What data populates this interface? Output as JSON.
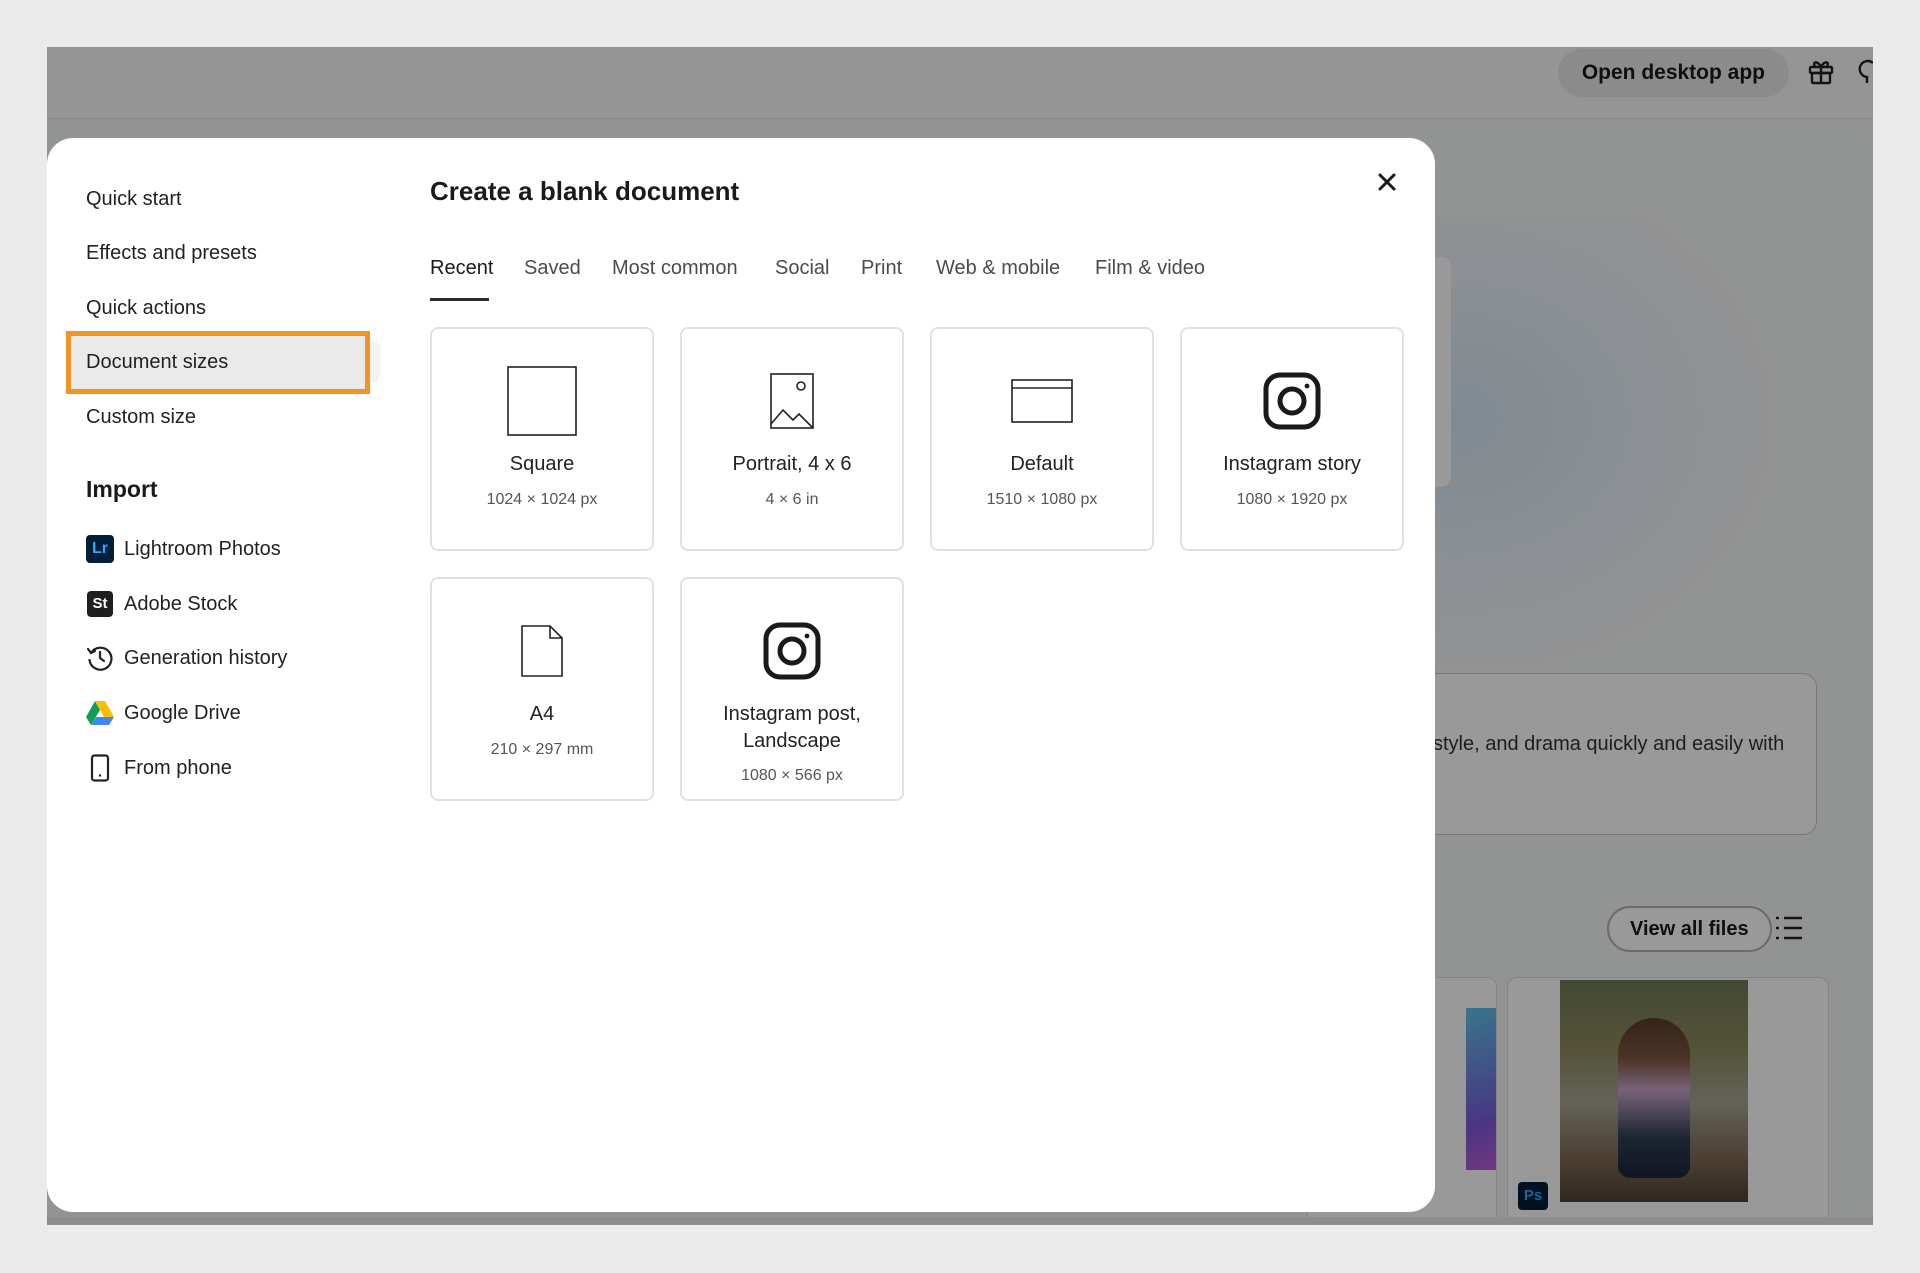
{
  "background": {
    "open_desktop_label": "Open desktop app",
    "promo_text": "style, and drama quickly and easily with",
    "view_all_label": "View all files",
    "ps_badge": "Ps"
  },
  "modal": {
    "title": "Create a blank document",
    "sidebar": {
      "items": [
        {
          "label": "Quick start"
        },
        {
          "label": "Effects and presets"
        },
        {
          "label": "Quick actions"
        },
        {
          "label": "Document sizes"
        },
        {
          "label": "Custom size"
        }
      ],
      "selected_index": 3,
      "import_heading": "Import",
      "import_items": [
        {
          "label": "Lightroom Photos",
          "icon": "lightroom-icon",
          "badge": "Lr"
        },
        {
          "label": "Adobe Stock",
          "icon": "adobe-stock-icon",
          "badge": "St"
        },
        {
          "label": "Generation history",
          "icon": "history-icon"
        },
        {
          "label": "Google Drive",
          "icon": "google-drive-icon"
        },
        {
          "label": "From phone",
          "icon": "phone-icon"
        }
      ]
    },
    "tabs": [
      {
        "label": "Recent",
        "active": true
      },
      {
        "label": "Saved"
      },
      {
        "label": "Most common"
      },
      {
        "label": "Social"
      },
      {
        "label": "Print"
      },
      {
        "label": "Web & mobile"
      },
      {
        "label": "Film & video"
      }
    ],
    "presets": [
      {
        "name": "Square",
        "dims": "1024 × 1024 px",
        "icon": "square-icon"
      },
      {
        "name": "Portrait, 4 x 6",
        "dims": "4 × 6 in",
        "icon": "portrait-image-icon"
      },
      {
        "name": "Default",
        "dims": "1510 × 1080 px",
        "icon": "browser-window-icon"
      },
      {
        "name": "Instagram story",
        "dims": "1080 × 1920 px",
        "icon": "instagram-icon"
      },
      {
        "name": "A4",
        "dims": "210 × 297 mm",
        "icon": "document-page-icon"
      },
      {
        "name": "Instagram post, Landscape",
        "dims": "1080 × 566 px",
        "icon": "instagram-icon"
      }
    ],
    "colors": {
      "highlight_border": "#f29423",
      "card_border": "#e1e1e1"
    }
  }
}
